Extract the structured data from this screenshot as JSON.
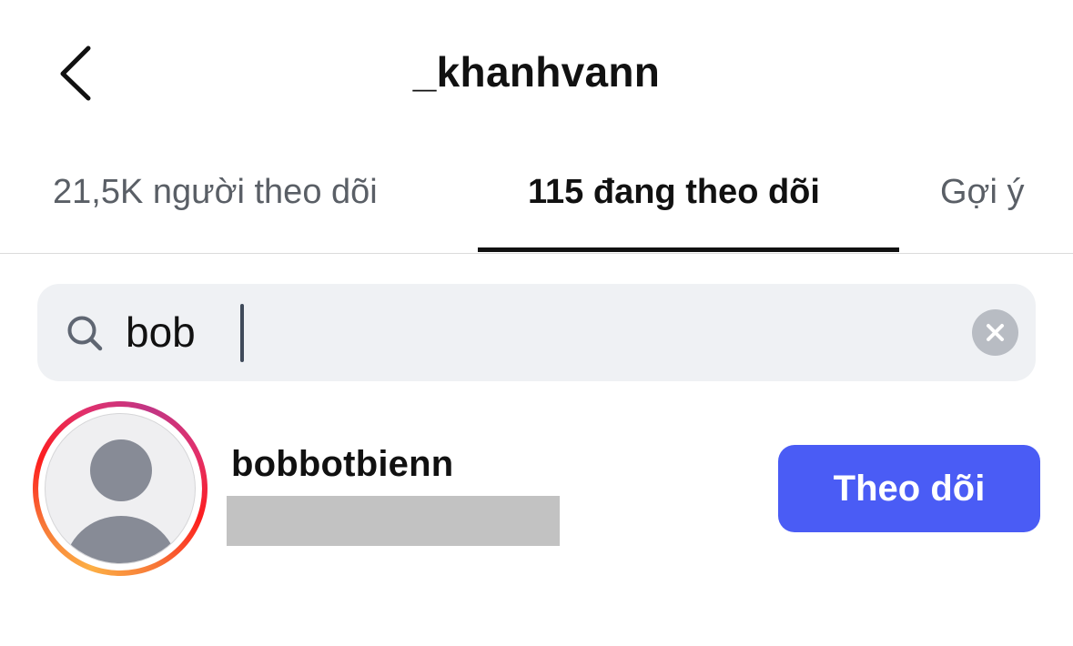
{
  "header": {
    "title": "_khanhvann",
    "back_icon": "chevron-left-icon"
  },
  "tabs": {
    "followers": "21,5K người theo dõi",
    "following": "115 đang theo dõi",
    "suggestions": "Gợi ý",
    "active": "following"
  },
  "search": {
    "value": "bob",
    "icon": "search-icon",
    "clear_icon": "clear-icon"
  },
  "results": [
    {
      "username": "bobbotbienn",
      "follow_label": "Theo dõi",
      "avatar_icon": "default-avatar-icon"
    }
  ],
  "colors": {
    "accent": "#4a5cf5",
    "search_bg": "#eff1f4",
    "inactive_tab": "#5a5f66",
    "redaction": "#c2c2c2"
  }
}
